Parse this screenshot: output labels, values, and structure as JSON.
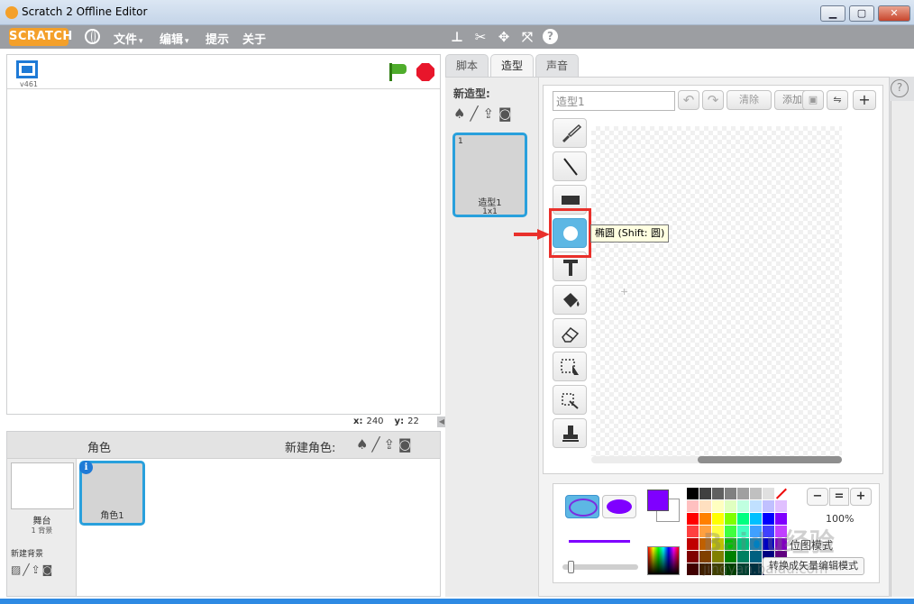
{
  "window": {
    "title": "Scratch 2 Offline Editor",
    "minimize": "▁",
    "maximize": "▢",
    "close": "✕"
  },
  "menubar": {
    "logo": "SCRATCH",
    "items": [
      {
        "label": "文件",
        "caret": "▾"
      },
      {
        "label": "编辑",
        "caret": "▾"
      },
      {
        "label": "提示"
      },
      {
        "label": "关于"
      }
    ],
    "toolbar_icons": [
      "duplicate-icon",
      "cut-icon",
      "grow-icon",
      "shrink-icon",
      "help-icon"
    ],
    "help": "?"
  },
  "stage": {
    "version": "v461",
    "x_label": "x:",
    "x_value": "240",
    "y_label": "y:",
    "y_value": "22"
  },
  "sprites": {
    "title": "角色",
    "new_sprite_label": "新建角色:",
    "sprite_name": "角色1",
    "stage_label": "舞台",
    "stage_backdrops": "1 背景",
    "new_backdrop_label": "新建背景"
  },
  "tabs": [
    {
      "label": "脚本"
    },
    {
      "label": "造型",
      "active": true
    },
    {
      "label": "声音"
    }
  ],
  "costumes": {
    "new_costume_label": "新造型:",
    "items": [
      {
        "number": "1",
        "name": "造型1",
        "size": "1x1"
      }
    ]
  },
  "paint_editor": {
    "costume_name": "造型1",
    "clear_label": "清除",
    "add_label": "添加",
    "tooltip": "椭圆 (Shift: 圆)",
    "zoom_level": "100%",
    "mode_label": "位图模式",
    "convert_label": "转换成矢量编辑模式",
    "primary_color": "#7f00ff",
    "secondary_color": "#ffffff",
    "swatches": [
      "#000000",
      "#404040",
      "#606060",
      "#808080",
      "#a0a0a0",
      "#c0c0c0",
      "#e0e0e0",
      "none",
      "#ffc0c0",
      "#ffe0c0",
      "#ffffc0",
      "#e0ffc0",
      "#c0ffe0",
      "#c0e0ff",
      "#c0c0ff",
      "#e0c0ff",
      "#ff0000",
      "#ff8000",
      "#ffff00",
      "#80ff00",
      "#00ff80",
      "#00c0ff",
      "#0000ff",
      "#8000ff",
      "#ff4040",
      "#ffa040",
      "#ffff40",
      "#40ff40",
      "#40ffc0",
      "#40a0ff",
      "#4040ff",
      "#c040ff",
      "#c00000",
      "#c06000",
      "#c0c000",
      "#00c000",
      "#00c080",
      "#0080c0",
      "#0000c0",
      "#8000c0",
      "#800000",
      "#804000",
      "#808000",
      "#008000",
      "#008060",
      "#006080",
      "#000080",
      "#600080",
      "#400000",
      "#402000",
      "#404000",
      "#004000",
      "#004030",
      "#003040",
      "#000040",
      "#300040"
    ]
  },
  "watermark": {
    "text": "Baidu经验",
    "sub": "jingyan.baidu.com"
  }
}
